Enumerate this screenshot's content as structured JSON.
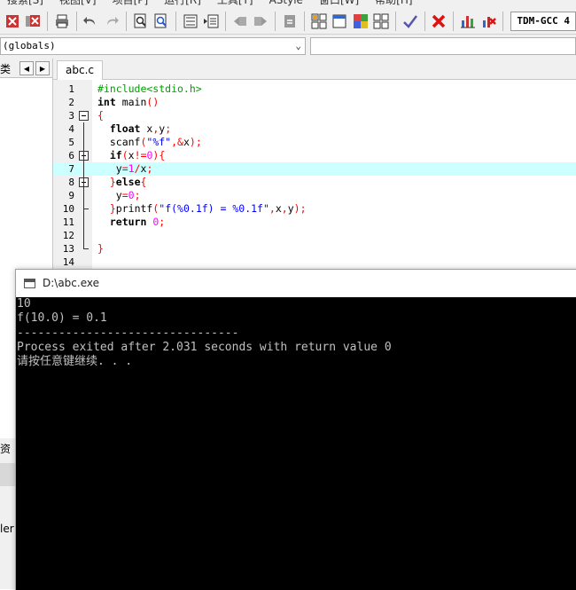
{
  "menu": [
    "搜索[S]",
    "视图[V]",
    "项目[P]",
    "运行[R]",
    "工具[T]",
    "AStyle",
    "窗口[W]",
    "帮助[H]"
  ],
  "toolbar": {
    "compiler": "TDM-GCC 4"
  },
  "scope": {
    "value": "(globals)"
  },
  "left_panel": {
    "tab_label": "类",
    "lower_label": "资",
    "lower_text": "ler"
  },
  "editor": {
    "tab": "abc.c",
    "lines": [
      "1",
      "2",
      "3",
      "4",
      "5",
      "6",
      "7",
      "8",
      "9",
      "10",
      "11",
      "12",
      "13",
      "14"
    ]
  },
  "console": {
    "title": "D:\\abc.exe",
    "output": "10\nf(10.0) = 0.1\n--------------------------------\nProcess exited after 2.031 seconds with return value 0\n请按任意键继续. . ."
  }
}
